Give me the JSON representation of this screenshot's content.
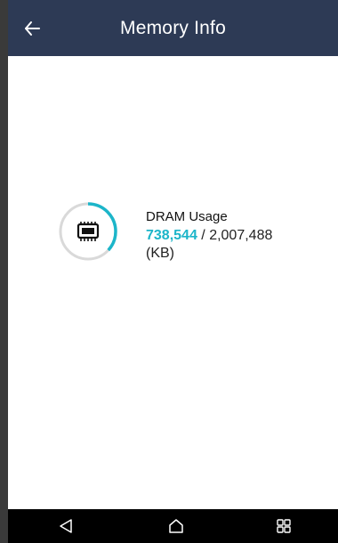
{
  "header": {
    "title": "Memory Info",
    "back_icon": "back-arrow-icon"
  },
  "memory": {
    "label": "DRAM Usage",
    "used": "738,544",
    "separator": " / ",
    "total": "2,007,488",
    "unit": "(KB)",
    "usage_fraction": 0.368,
    "accent_color": "#1cb5c9",
    "track_color": "#d9d9d9"
  },
  "nav": {
    "back_icon": "nav-back-icon",
    "home_icon": "nav-home-icon",
    "recents_icon": "nav-recents-icon"
  },
  "colors": {
    "app_bar": "#2d3a55",
    "nav_bar": "#000000"
  }
}
